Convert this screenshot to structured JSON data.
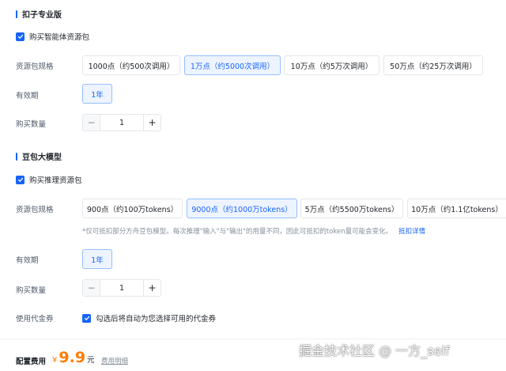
{
  "section1": {
    "title": "扣子专业版",
    "checkbox_label": "购买智能体资源包",
    "spec_label": "资源包规格",
    "spec_options": [
      "1000点（约500次调用）",
      "1万点（约5000次调用）",
      "10万点（约5万次调用）",
      "50万点（约25万次调用）"
    ],
    "selected_spec": "1万点（约5000次调用）",
    "validity_label": "有效期",
    "validity_value": "1年",
    "qty_label": "购买数量",
    "qty_value": "1"
  },
  "section2": {
    "title": "豆包大模型",
    "checkbox_label": "购买推理资源包",
    "spec_label": "资源包规格",
    "spec_options": [
      "900点（约100万tokens）",
      "9000点（约1000万tokens）",
      "5万点（约5500万tokens）",
      "10万点（约1.1亿tokens）"
    ],
    "selected_spec": "9000点（约1000万tokens）",
    "note": "*仅可抵扣部分方舟豆包模型。每次推理\"输入\"与\"输出\"的用量不同，因此可抵扣的token量可能会变化。",
    "note_link": "抵扣详情",
    "validity_label": "有效期",
    "validity_value": "1年",
    "qty_label": "购买数量",
    "qty_value": "1",
    "voucher_label": "使用代金券",
    "voucher_text": "勾选后将自动为您选择可用的代金券"
  },
  "footer": {
    "fee_label": "配置费用",
    "currency": "¥",
    "amount": "9.9",
    "unit": "元",
    "detail_link": "费用明细"
  },
  "watermark": "掘金技术社区 @ 一方_self",
  "colors": {
    "accent": "#1664ff",
    "price": "#ff7d00"
  },
  "icons": {
    "checkbox": "check-icon",
    "minus": "minus-icon",
    "plus": "plus-icon"
  }
}
